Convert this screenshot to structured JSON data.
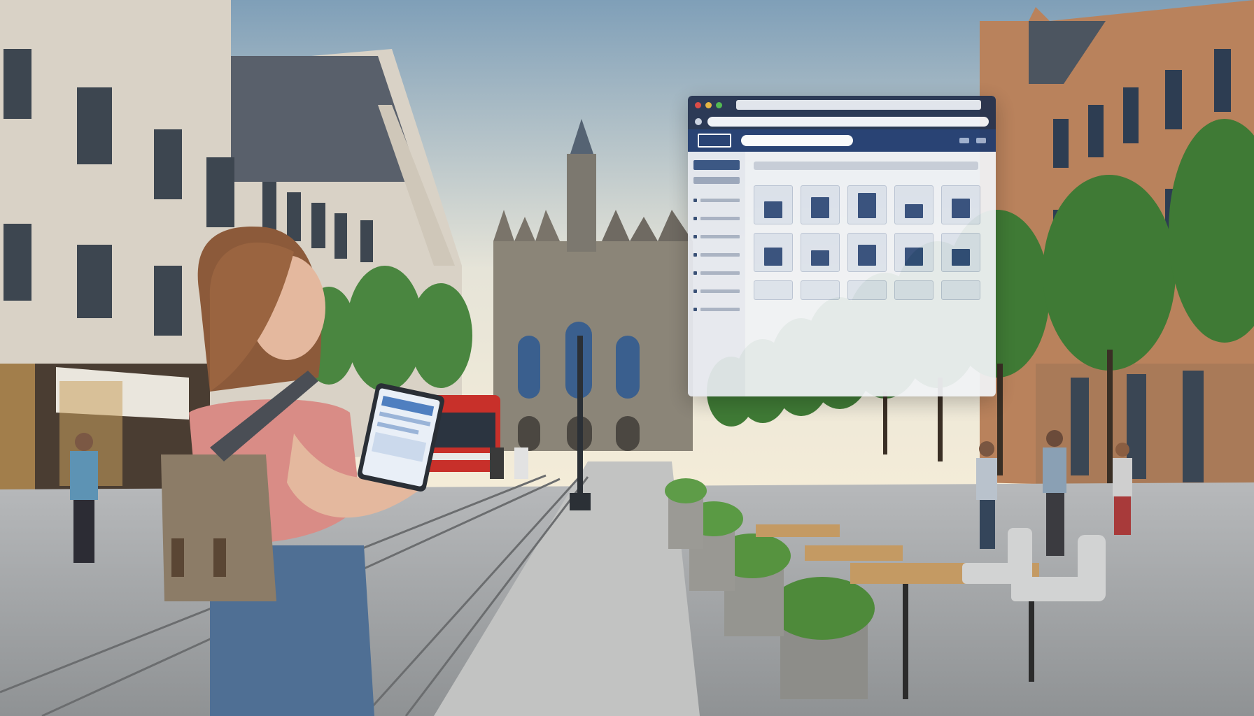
{
  "scene": {
    "description_tag": "street-scene",
    "colors": {
      "sky_top": "#7f9fb8",
      "sky_horizon": "#f4ecd8",
      "building_left": "#d9d2c6",
      "building_right": "#b9825c",
      "cathedral": "#8b8578",
      "pavement": "#9c9ea0",
      "tree": "#3f7a35",
      "tram_red": "#c8302a",
      "shirt": "#d98c86",
      "jeans": "#4f6f94",
      "backpack": "#8c7c67",
      "browser_header": "#23314e",
      "browser_accent": "#1f3a6e"
    }
  },
  "browser_window": {
    "traffic_lights": [
      "#e0443e",
      "#e9b53b",
      "#4dbb4a"
    ],
    "tiles": [
      {
        "icon": "building-icon"
      },
      {
        "icon": "building-icon"
      },
      {
        "icon": "building-icon"
      },
      {
        "icon": "building-icon"
      },
      {
        "icon": "building-icon"
      },
      {
        "icon": "building-icon"
      },
      {
        "icon": "building-icon"
      },
      {
        "icon": "building-icon"
      },
      {
        "icon": "building-icon"
      },
      {
        "icon": "building-icon"
      }
    ]
  }
}
